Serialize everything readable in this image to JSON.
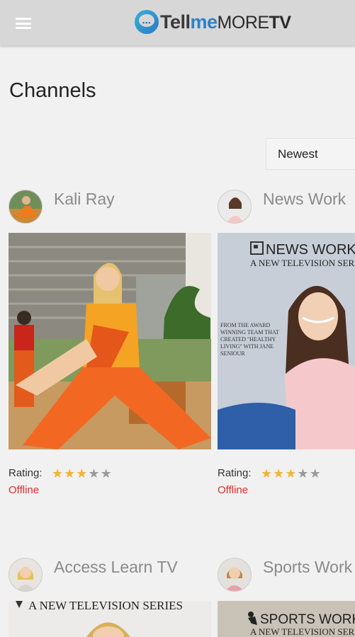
{
  "header": {
    "logo": {
      "tell": "Tell",
      "me": "me",
      "more": "MORE",
      "tv": "TV"
    }
  },
  "page": {
    "title": "Channels"
  },
  "sort": {
    "selected": "Newest"
  },
  "channels": [
    {
      "name": "Kali Ray",
      "rating_label": "Rating:",
      "rating": 3,
      "max_rating": 5,
      "status": "Offline"
    },
    {
      "name": "News Work",
      "rating_label": "Rating:",
      "rating": 3,
      "max_rating": 5,
      "status": "Offline",
      "thumb_title": "NEWS WORK",
      "thumb_subtitle": "A NEW TELEVISION SERIES",
      "thumb_caption": "FROM THE AWARD WINNING TEAM THAT CREATED \"HEALTHY LIVING\" WITH JANE SENIOUR"
    },
    {
      "name": "Access Learn TV",
      "thumb_subtitle": "A NEW TELEVISION SERIES"
    },
    {
      "name": "Sports Work",
      "thumb_title": "SPORTS WORK",
      "thumb_subtitle": "A NEW TELEVISION SERIES"
    }
  ],
  "colors": {
    "accent": "#2f80c8",
    "offline": "#e02b2b",
    "star": "#f0b43a"
  }
}
